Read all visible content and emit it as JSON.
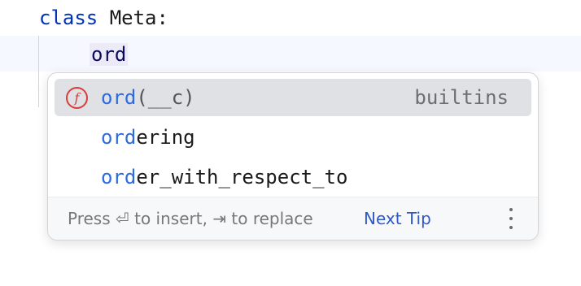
{
  "editor": {
    "line1": {
      "keyword": "class",
      "rest": " Meta:"
    },
    "line2": {
      "typed": "ord"
    }
  },
  "completion_popup": {
    "items": [
      {
        "icon": "function-icon",
        "icon_glyph": "f",
        "match": "ord",
        "rest": "",
        "params": "(__c)",
        "type": "builtins",
        "selected": true
      },
      {
        "match": "ord",
        "rest": "ering",
        "params": "",
        "type": "",
        "selected": false
      },
      {
        "match": "ord",
        "rest": "er_with_respect_to",
        "params": "",
        "type": "",
        "selected": false
      }
    ],
    "footer": {
      "hint": "Press ⏎ to insert, ⇥ to replace",
      "next_tip": "Next Tip",
      "more_icon": "vertical-ellipsis-icon"
    }
  }
}
